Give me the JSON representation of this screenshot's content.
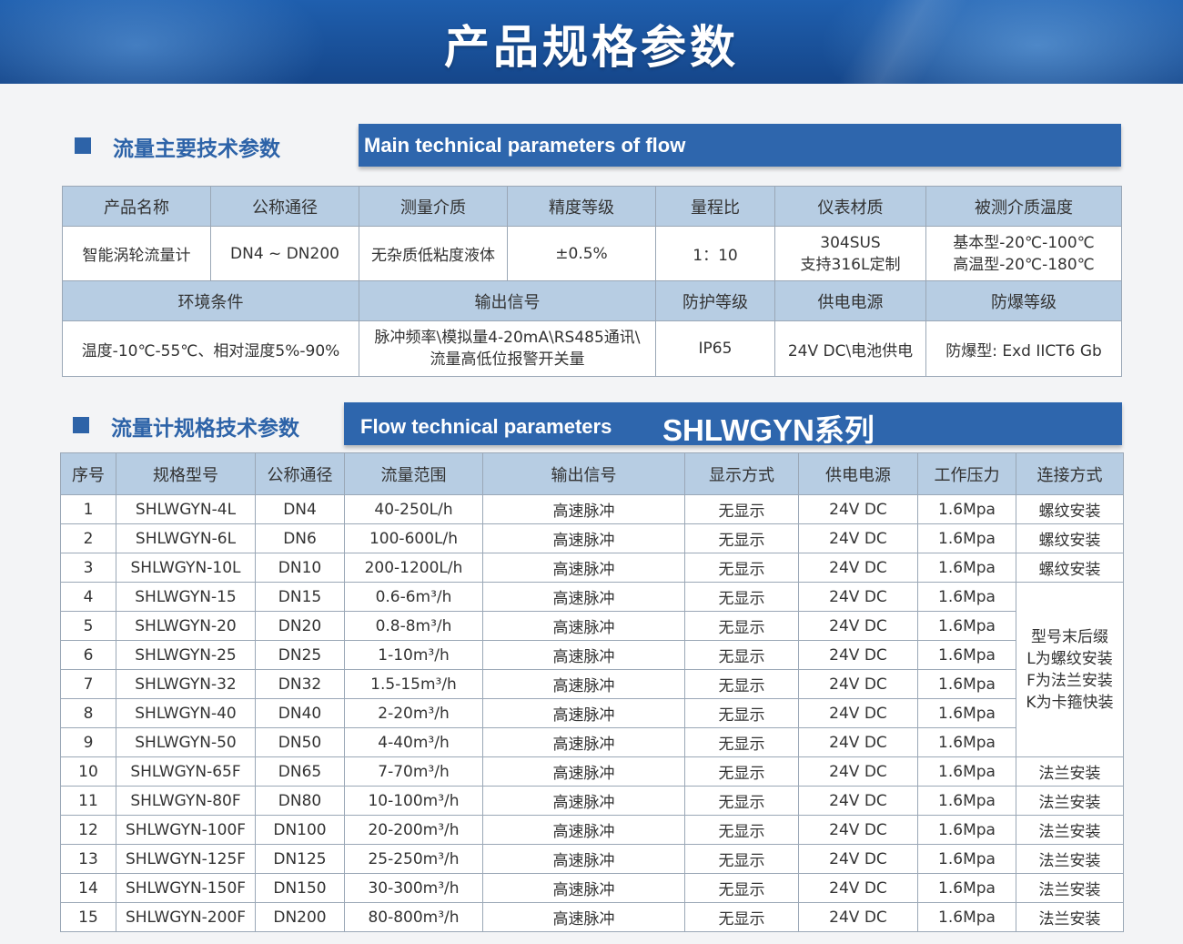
{
  "banner": {
    "title": "产品规格参数"
  },
  "section1": {
    "cn_title": "流量主要技术参数",
    "en_title": "Main technical parameters of flow",
    "row1_headers": [
      "产品名称",
      "公称通径",
      "测量介质",
      "精度等级",
      "量程比",
      "仪表材质",
      "被测介质温度"
    ],
    "row1_values": {
      "product": "智能涡轮流量计",
      "diameter": "DN4 ~ DN200",
      "medium": "无杂质低粘度液体",
      "accuracy": "±0.5%",
      "range_ratio": "1：10",
      "material_line1": "304SUS",
      "material_line2": "支持316L定制",
      "temp_line1": "基本型-20℃-100℃",
      "temp_line2": "高温型-20℃-180℃"
    },
    "row2_headers": [
      "环境条件",
      "输出信号",
      "防护等级",
      "供电电源",
      "防爆等级"
    ],
    "row2_values": {
      "environment": "温度-10℃-55℃、相对湿度5%-90%",
      "output_line1": "脉冲频率\\模拟量4-20mA\\RS485通讯\\",
      "output_line2": "流量高低位报警开关量",
      "protection": "IP65",
      "power": "24V DC\\电池供电",
      "explosion": "防爆型:  Exd IICT6  Gb"
    }
  },
  "section2": {
    "cn_title": "流量计规格技术参数",
    "en_title": "Flow technical parameters",
    "en_series": "SHLWGYN系列",
    "headers": [
      "序号",
      "规格型号",
      "公称通径",
      "流量范围",
      "输出信号",
      "显示方式",
      "供电电源",
      "工作压力",
      "连接方式"
    ],
    "rows": [
      [
        "1",
        "SHLWGYN-4L",
        "DN4",
        "40-250L/h",
        "高速脉冲",
        "无显示",
        "24V DC",
        "1.6Mpa"
      ],
      [
        "2",
        "SHLWGYN-6L",
        "DN6",
        "100-600L/h",
        "高速脉冲",
        "无显示",
        "24V DC",
        "1.6Mpa"
      ],
      [
        "3",
        "SHLWGYN-10L",
        "DN10",
        "200-1200L/h",
        "高速脉冲",
        "无显示",
        "24V DC",
        "1.6Mpa"
      ],
      [
        "4",
        "SHLWGYN-15",
        "DN15",
        "0.6-6m³/h",
        "高速脉冲",
        "无显示",
        "24V DC",
        "1.6Mpa"
      ],
      [
        "5",
        "SHLWGYN-20",
        "DN20",
        "0.8-8m³/h",
        "高速脉冲",
        "无显示",
        "24V DC",
        "1.6Mpa"
      ],
      [
        "6",
        "SHLWGYN-25",
        "DN25",
        "1-10m³/h",
        "高速脉冲",
        "无显示",
        "24V DC",
        "1.6Mpa"
      ],
      [
        "7",
        "SHLWGYN-32",
        "DN32",
        "1.5-15m³/h",
        "高速脉冲",
        "无显示",
        "24V DC",
        "1.6Mpa"
      ],
      [
        "8",
        "SHLWGYN-40",
        "DN40",
        "2-20m³/h",
        "高速脉冲",
        "无显示",
        "24V DC",
        "1.6Mpa"
      ],
      [
        "9",
        "SHLWGYN-50",
        "DN50",
        "4-40m³/h",
        "高速脉冲",
        "无显示",
        "24V DC",
        "1.6Mpa"
      ],
      [
        "10",
        "SHLWGYN-65F",
        "DN65",
        "7-70m³/h",
        "高速脉冲",
        "无显示",
        "24V DC",
        "1.6Mpa"
      ],
      [
        "11",
        "SHLWGYN-80F",
        "DN80",
        "10-100m³/h",
        "高速脉冲",
        "无显示",
        "24V DC",
        "1.6Mpa"
      ],
      [
        "12",
        "SHLWGYN-100F",
        "DN100",
        "20-200m³/h",
        "高速脉冲",
        "无显示",
        "24V DC",
        "1.6Mpa"
      ],
      [
        "13",
        "SHLWGYN-125F",
        "DN125",
        "25-250m³/h",
        "高速脉冲",
        "无显示",
        "24V DC",
        "1.6Mpa"
      ],
      [
        "14",
        "SHLWGYN-150F",
        "DN150",
        "30-300m³/h",
        "高速脉冲",
        "无显示",
        "24V DC",
        "1.6Mpa"
      ],
      [
        "15",
        "SHLWGYN-200F",
        "DN200",
        "80-800m³/h",
        "高速脉冲",
        "无显示",
        "24V DC",
        "1.6Mpa"
      ]
    ],
    "connection": {
      "r1": "螺纹安装",
      "r2": "螺纹安装",
      "r3": "螺纹安装",
      "merged_lines": [
        "型号末后缀",
        "L为螺纹安装",
        "F为法兰安装",
        "K为卡箍快装"
      ],
      "r10": "法兰安装",
      "r11": "法兰安装",
      "r12": "法兰安装",
      "r13": "法兰安装",
      "r14": "法兰安装",
      "r15": "法兰安装"
    }
  }
}
